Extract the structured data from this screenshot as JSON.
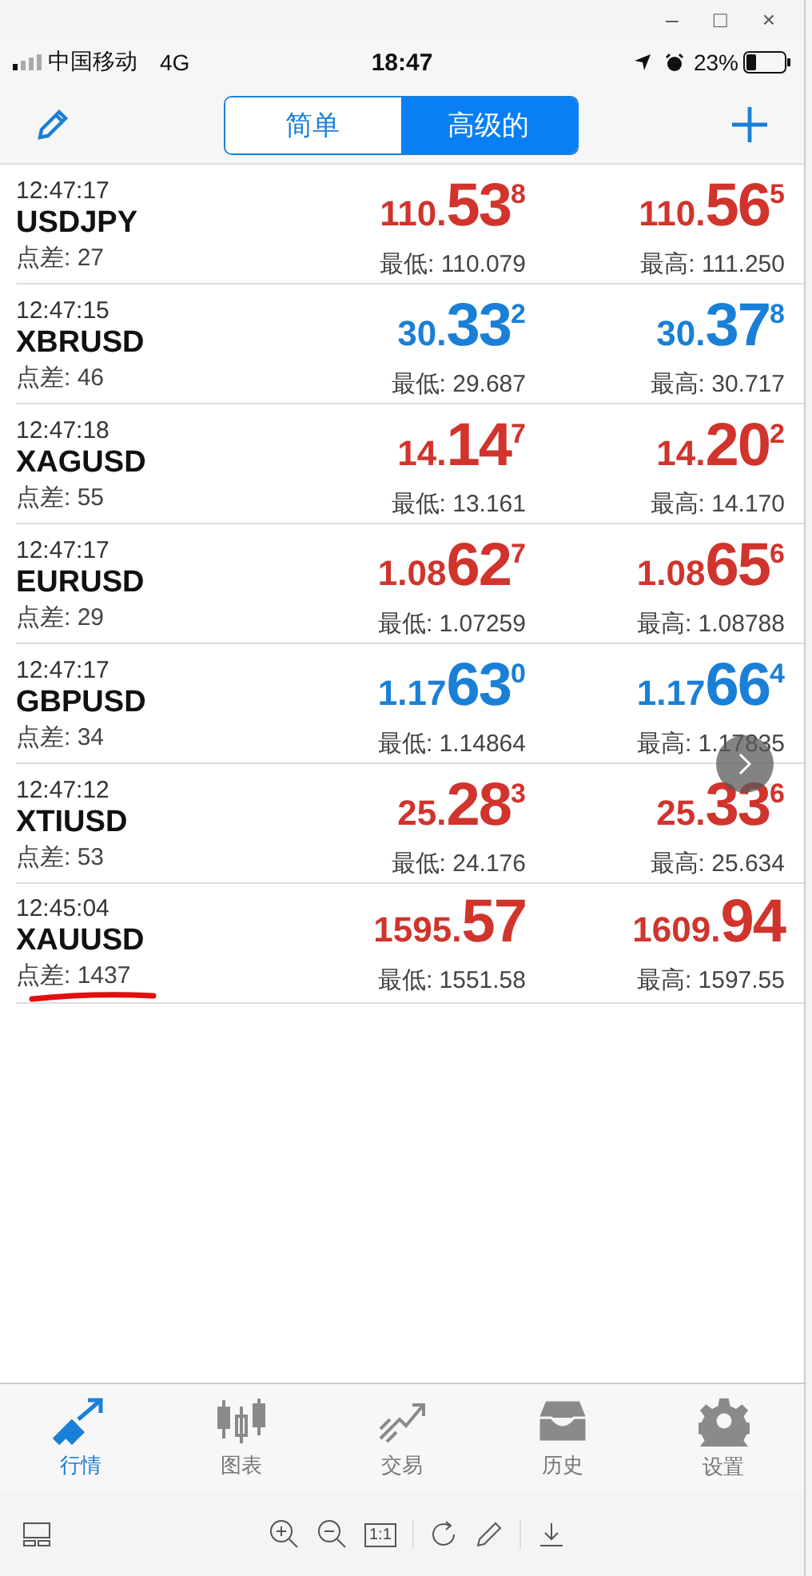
{
  "window_controls": [
    "–",
    "□",
    "×"
  ],
  "status_bar": {
    "carrier": "中国移动",
    "network": "4G",
    "time": "18:47",
    "battery": "23%"
  },
  "segmented": [
    {
      "label": "简单",
      "selected": false
    },
    {
      "label": "高级的",
      "selected": true
    }
  ],
  "rows": [
    {
      "time": "12:47:17",
      "symbol": "USDJPY",
      "spread": "点差: 27",
      "color": "#d0342c",
      "bid": {
        "prefix": "110.",
        "big": "53",
        "sup": "8"
      },
      "ask": {
        "prefix": "110.",
        "big": "56",
        "sup": "5"
      },
      "low": "最低: 110.079",
      "high": "最高: 111.250"
    },
    {
      "time": "12:47:15",
      "symbol": "XBRUSD",
      "spread": "点差: 46",
      "color": "#1a7fd6",
      "bid": {
        "prefix": "30.",
        "big": "33",
        "sup": "2"
      },
      "ask": {
        "prefix": "30.",
        "big": "37",
        "sup": "8"
      },
      "low": "最低: 29.687",
      "high": "最高: 30.717"
    },
    {
      "time": "12:47:18",
      "symbol": "XAGUSD",
      "spread": "点差: 55",
      "color": "#d0342c",
      "bid": {
        "prefix": "14.",
        "big": "14",
        "sup": "7"
      },
      "ask": {
        "prefix": "14.",
        "big": "20",
        "sup": "2"
      },
      "low": "最低: 13.161",
      "high": "最高: 14.170"
    },
    {
      "time": "12:47:17",
      "symbol": "EURUSD",
      "spread": "点差: 29",
      "color": "#d0342c",
      "bid": {
        "prefix": "1.08",
        "big": "62",
        "sup": "7"
      },
      "ask": {
        "prefix": "1.08",
        "big": "65",
        "sup": "6"
      },
      "low": "最低: 1.07259",
      "high": "最高: 1.08788"
    },
    {
      "time": "12:47:17",
      "symbol": "GBPUSD",
      "spread": "点差: 34",
      "color": "#1a7fd6",
      "bid": {
        "prefix": "1.17",
        "big": "63",
        "sup": "0"
      },
      "ask": {
        "prefix": "1.17",
        "big": "66",
        "sup": "4"
      },
      "low": "最低: 1.14864",
      "high": "最高: 1.17835"
    },
    {
      "time": "12:47:12",
      "symbol": "XTIUSD",
      "spread": "点差: 53",
      "color": "#d0342c",
      "bid": {
        "prefix": "25.",
        "big": "28",
        "sup": "3"
      },
      "ask": {
        "prefix": "25.",
        "big": "33",
        "sup": "6"
      },
      "low": "最低: 24.176",
      "high": "最高: 25.634"
    },
    {
      "time": "12:45:04",
      "symbol": "XAUUSD",
      "spread": "点差: 1437",
      "color": "#d0342c",
      "underlined": true,
      "bid": {
        "prefix": "1595.",
        "big": "57"
      },
      "ask": {
        "prefix": "1609.",
        "big": "94"
      },
      "low": "最低: 1551.58",
      "high": "最高: 1597.55"
    }
  ],
  "tab_bar": [
    {
      "label": "行情",
      "kind": "arrows",
      "selected": true
    },
    {
      "label": "图表",
      "kind": "candles",
      "selected": false
    },
    {
      "label": "交易",
      "kind": "trend",
      "selected": false
    },
    {
      "label": "历史",
      "kind": "inbox",
      "selected": false
    },
    {
      "label": "设置",
      "kind": "gear",
      "selected": false
    }
  ],
  "viewer_toolbar": {
    "actual_size": "1:1"
  }
}
